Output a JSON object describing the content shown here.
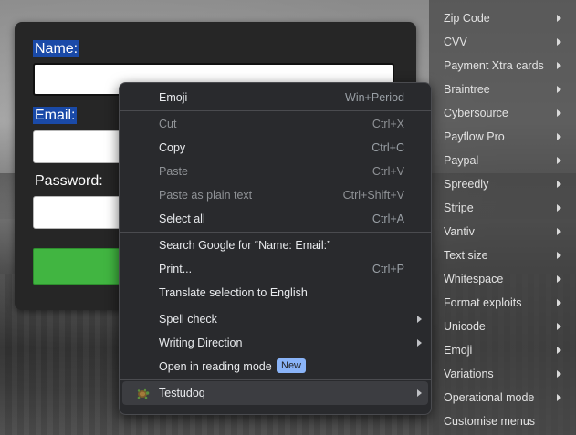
{
  "form": {
    "name_label": "Name:",
    "email_label": "Email:",
    "password_label": "Password:"
  },
  "context_menu": {
    "emoji": {
      "label": "Emoji",
      "shortcut": "Win+Period"
    },
    "cut": {
      "label": "Cut",
      "shortcut": "Ctrl+X"
    },
    "copy": {
      "label": "Copy",
      "shortcut": "Ctrl+C"
    },
    "paste": {
      "label": "Paste",
      "shortcut": "Ctrl+V"
    },
    "paste_plain": {
      "label": "Paste as plain text",
      "shortcut": "Ctrl+Shift+V"
    },
    "select_all": {
      "label": "Select all",
      "shortcut": "Ctrl+A"
    },
    "search_google": {
      "label": "Search Google for “Name:  Email:”"
    },
    "print": {
      "label": "Print...",
      "shortcut": "Ctrl+P"
    },
    "translate": {
      "label": "Translate selection to English"
    },
    "spell_check": {
      "label": "Spell check"
    },
    "writing_direction": {
      "label": "Writing Direction"
    },
    "reading_mode": {
      "label": "Open in reading mode",
      "badge": "New"
    },
    "testudoq": {
      "label": "Testudoq"
    }
  },
  "side_menu": {
    "items": [
      "Zip Code",
      "CVV",
      "Payment Xtra cards",
      "Braintree",
      "Cybersource",
      "Payflow Pro",
      "Paypal",
      "Spreedly",
      "Stripe",
      "Vantiv",
      "Text size",
      "Whitespace",
      "Format exploits",
      "Unicode",
      "Emoji",
      "Variations",
      "Operational mode",
      "Customise menus"
    ]
  }
}
